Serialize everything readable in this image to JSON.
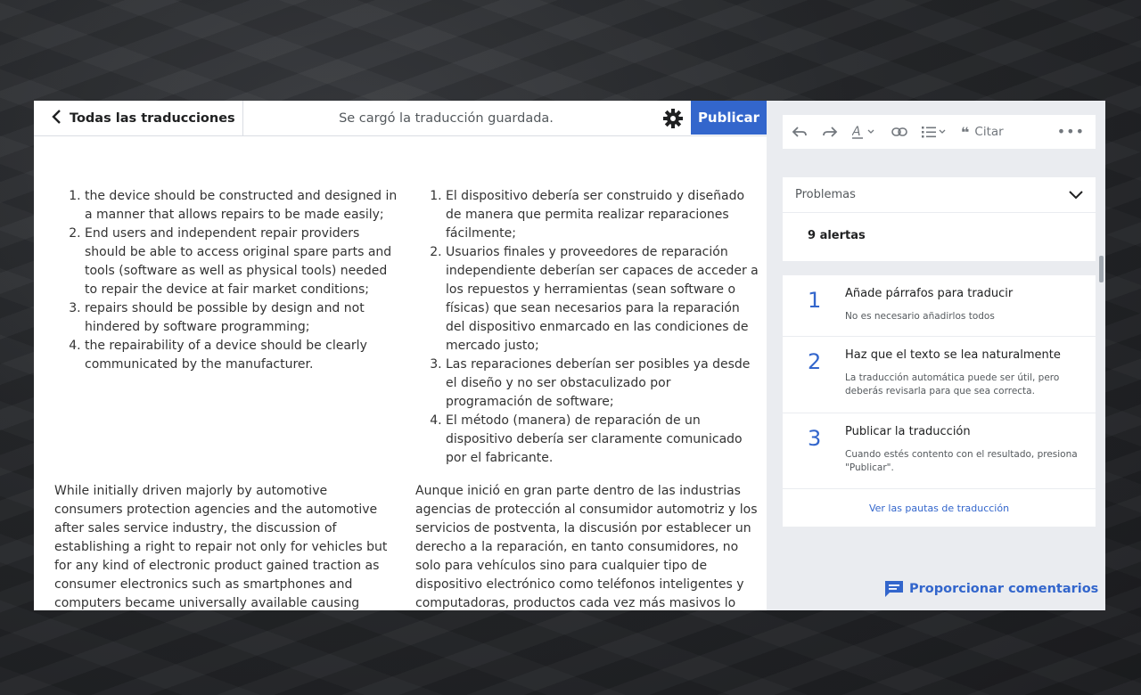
{
  "topbar": {
    "back_label": "Todas las traducciones",
    "status": "Se cargó la traducción guardada.",
    "publish_label": "Publicar"
  },
  "source": {
    "list": [
      "the device should be constructed and designed in a manner that allows repairs to be made easily;",
      "End users and independent repair providers should be able to access original spare parts and tools (software as well as physical tools) needed to repair the device at fair market conditions;",
      "repairs should be possible by design and not hindered by software programming;",
      "the repairability of a device should be clearly communicated by the manufacturer."
    ],
    "paragraph": "While initially driven majorly by automotive consumers protection agencies and the automotive after sales service industry, the discussion of establishing a right to repair not only for vehicles but for any kind of electronic product gained traction as consumer electronics such as smartphones and computers became universally available causing"
  },
  "target": {
    "list": [
      "El dispositivo debería ser construido y diseñado de manera que permita realizar reparaciones fácilmente;",
      "Usuarios finales y proveedores de reparación independiente deberían ser capaces de acceder a los repuestos y herramientas (sean software o físicas) que sean necesarios para la reparación del dispositivo enmarcado en las condiciones de mercado justo;",
      "Las reparaciones deberían ser posibles ya desde el diseño y no ser obstaculizado por programación de software;",
      "El método (manera) de reparación de un dispositivo debería ser claramente comunicado por el fabricante."
    ],
    "paragraph": "Aunque inició en gran parte dentro de las industrias agencias de protección al consumidor automotriz y los servicios de postventa, la discusión por establecer un derecho a la reparación, en tanto consumidores, no solo para vehículos sino para cualquier tipo de dispositivo electrónico como teléfonos inteligentes y computadoras, productos cada vez más masivos lo"
  },
  "toolbar": {
    "cite_label": "Citar",
    "more": "•••"
  },
  "problems": {
    "title": "Problemas",
    "count": "9 alertas"
  },
  "steps": [
    {
      "num": "1",
      "title": "Añade párrafos para traducir",
      "desc": "No es necesario añadirlos todos"
    },
    {
      "num": "2",
      "title": "Haz que el texto se lea naturalmente",
      "desc": "La traducción automática puede ser útil, pero deberás revisarla para que sea correcta."
    },
    {
      "num": "3",
      "title": "Publicar la traducción",
      "desc": "Cuando estés contento con el resultado, presiona \"Publicar\"."
    }
  ],
  "guidelines_link": "Ver las pautas de traducción",
  "feedback_label": "Proporcionar comentarios",
  "colors": {
    "accent": "#3366cc",
    "sidebar_bg": "#eaecf0"
  },
  "icons": [
    "chevron-left-icon",
    "gear-icon",
    "undo-icon",
    "redo-icon",
    "text-style-icon",
    "link-icon",
    "list-icon",
    "quote-icon",
    "chevron-down-icon",
    "feedback-icon"
  ]
}
